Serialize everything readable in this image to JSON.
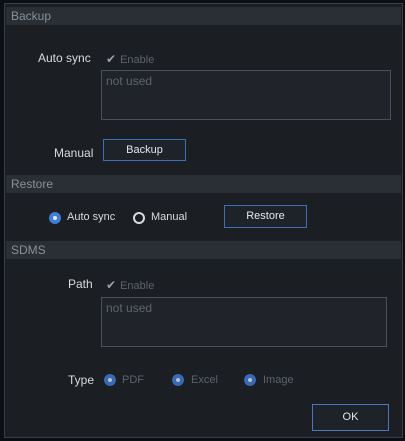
{
  "backup": {
    "header": "Backup",
    "auto_sync_label": "Auto sync",
    "enable_text": "Enable",
    "notes_placeholder": "not used",
    "manual_label": "Manual",
    "backup_button": "Backup"
  },
  "restore": {
    "header": "Restore",
    "auto_sync_option": "Auto sync",
    "manual_option": "Manual",
    "restore_button": "Restore",
    "selected": "Auto sync"
  },
  "sdms": {
    "header": "SDMS",
    "path_label": "Path",
    "enable_text": "Enable",
    "path_placeholder": "not used",
    "type_label": "Type",
    "type_options": [
      "PDF",
      "Excel",
      "Image"
    ]
  },
  "footer": {
    "ok_button": "OK"
  },
  "icons": {
    "check": "checkmark-icon"
  },
  "colors": {
    "accent": "#3e7ed6",
    "border": "#3d6fb8",
    "background": "#1b1e23"
  }
}
